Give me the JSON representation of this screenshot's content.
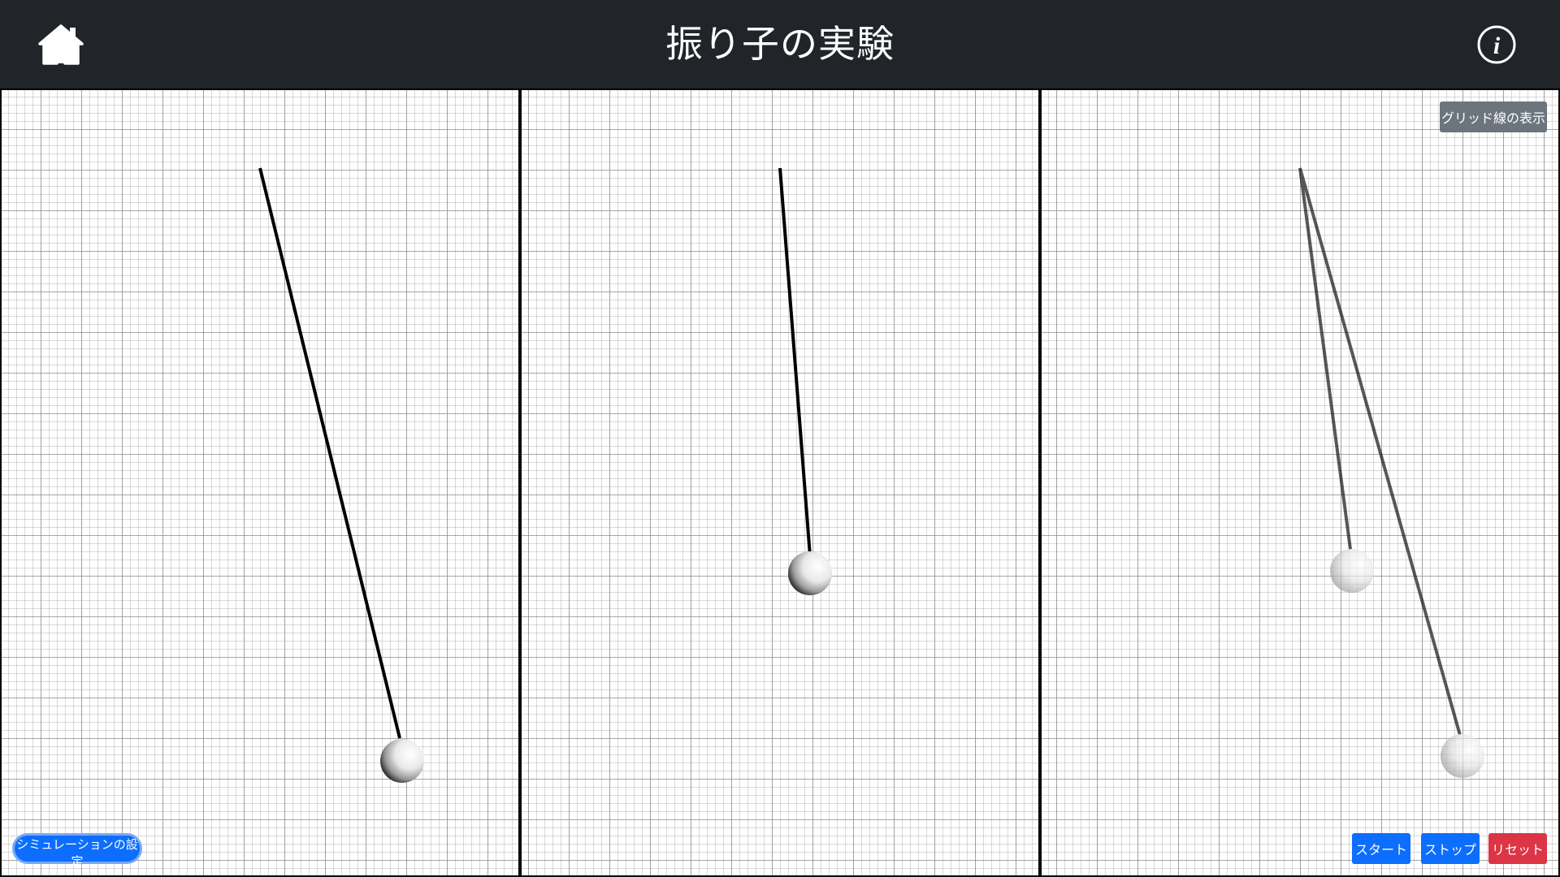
{
  "header": {
    "title": "振り子の実験",
    "home_icon": "home-icon",
    "info_icon": "info-icon",
    "info_glyph": "i"
  },
  "controls": {
    "grid_toggle_label": "グリッド線の表示",
    "settings_label": "シミュレーションの設定",
    "start_label": "スタート",
    "stop_label": "ストップ",
    "reset_label": "リセット"
  },
  "colors": {
    "header_bg": "#212429",
    "primary": "#0d6efd",
    "danger": "#dc3545",
    "secondary": "#6c757d"
  },
  "pendulums": [
    {
      "panel": 1,
      "angle_deg": -15.5,
      "ghost": false
    },
    {
      "panel": 2,
      "angle_deg": -4.2,
      "ghost": false
    },
    {
      "panel": 3,
      "angle_deg": -7.1,
      "ghost": true
    },
    {
      "panel": 3,
      "angle_deg": -17.5,
      "ghost": true
    }
  ]
}
